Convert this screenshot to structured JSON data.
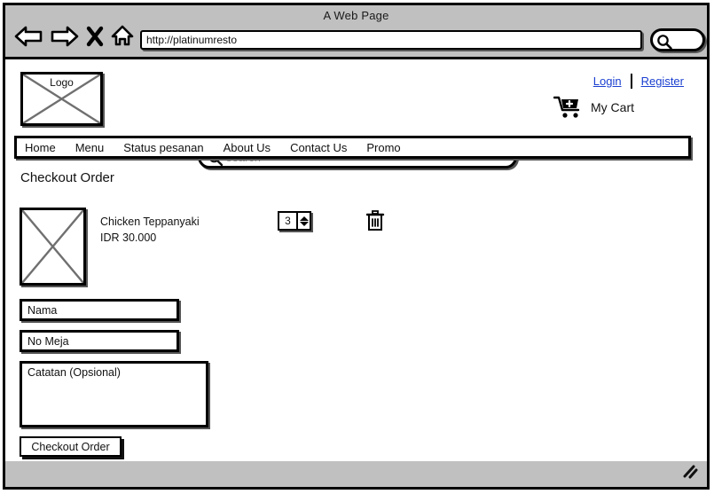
{
  "browser": {
    "window_title": "A Web Page",
    "url": "http://platinumresto",
    "toolbar_icons": [
      "back-arrow-icon",
      "forward-arrow-icon",
      "stop-x-icon",
      "home-icon"
    ],
    "browser_search_icon": "search-icon"
  },
  "header": {
    "logo_label": "Logo",
    "search": {
      "placeholder": "search",
      "icon": "search-icon"
    },
    "auth": {
      "login_label": "Login",
      "register_label": "Register"
    },
    "cart": {
      "label": "My Cart",
      "icon": "shopping-cart-add-icon"
    }
  },
  "nav": {
    "items": [
      {
        "label": "Home"
      },
      {
        "label": "Menu"
      },
      {
        "label": "Status pesanan"
      },
      {
        "label": "About Us"
      },
      {
        "label": "Contact Us"
      },
      {
        "label": "Promo"
      }
    ]
  },
  "main": {
    "page_title": "Checkout Order",
    "cart_items": [
      {
        "name": "Chicken Teppanyaki",
        "price": "IDR 30.000",
        "quantity": "3",
        "image_placeholder": "image-placeholder",
        "remove_icon": "trash-icon"
      }
    ],
    "form": {
      "nama": {
        "value": "Nama"
      },
      "no_meja": {
        "value": "No Meja"
      },
      "catatan": {
        "value": "Catatan (Opsional)"
      }
    },
    "submit_label": "Checkout Order"
  },
  "statusbar": {
    "resize_grip": "resize-grip-icon"
  },
  "colors": {
    "chrome": "#c0c0c0",
    "link": "#1a3fd0",
    "placeholder": "#999999",
    "line": "#000000",
    "cross": "#707070"
  }
}
